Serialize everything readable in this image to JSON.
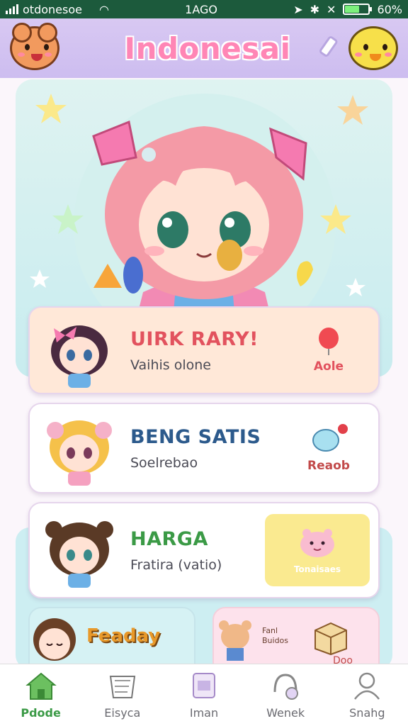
{
  "status_bar": {
    "carrier": "otdonesoe",
    "time": "1AGO",
    "battery": "60%",
    "battery_level": 0.6
  },
  "header": {
    "title": "Indonesai",
    "left_mascot": "bear-mascot",
    "right_mascot": "chick-mascot",
    "action_icon": "pen-icon"
  },
  "hero": {
    "image": "anime-girl-illustration"
  },
  "cards": [
    {
      "title": "UIRK RARY!",
      "subtitle": "Vaihis olone",
      "action": "Aole",
      "icon": "balloon-icon"
    },
    {
      "title": "BENG SATIS",
      "subtitle": "Soelrebao",
      "action": "Reaob",
      "icon": "chat-bubble-icon"
    },
    {
      "title": "HARGA",
      "subtitle": "Fratira (vatio)",
      "promo": "Tonaisaes",
      "icon": "pig-icon"
    }
  ],
  "bottom_tiles": [
    {
      "title": "Feaday"
    },
    {
      "small_line_1": "Fanl",
      "small_line_2": "Buidos",
      "label": "Doo"
    }
  ],
  "nav": [
    {
      "label": "Pdode",
      "icon": "home-icon",
      "active": true
    },
    {
      "label": "Eisyca",
      "icon": "book-icon",
      "active": false
    },
    {
      "label": "Iman",
      "icon": "calendar-icon",
      "active": false
    },
    {
      "label": "Wenek",
      "icon": "headphones-icon",
      "active": false
    },
    {
      "label": "Snahg",
      "icon": "profile-icon",
      "active": false
    }
  ],
  "colors": {
    "header_bg": "#cdbdf0",
    "title_pink": "#ff86b5",
    "accent_green": "#3b9a46",
    "card1_bg": "#ffe8d8",
    "status_bg": "#1c5a3c"
  }
}
